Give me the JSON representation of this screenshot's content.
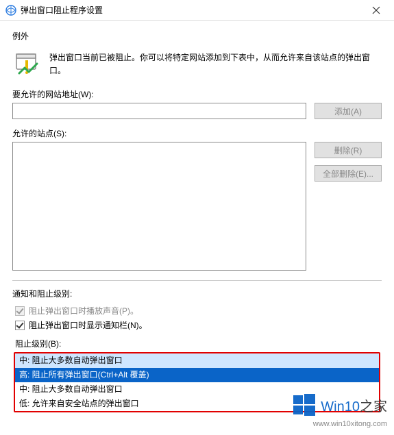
{
  "titlebar": {
    "title": "弹出窗口阻止程序设置",
    "close_label": "×"
  },
  "exceptions": {
    "group_label": "例外",
    "desc": "弹出窗口当前已被阻止。你可以将特定网站添加到下表中，从而允许来自该站点的弹出窗口。",
    "url_label": "要允许的网站地址(W):",
    "url_value": "",
    "add_btn": "添加(A)",
    "sites_label": "允许的站点(S):",
    "remove_btn": "删除(R)",
    "remove_all_btn": "全部删除(E)..."
  },
  "notify": {
    "group_label": "通知和阻止级别:",
    "play_sound": "阻止弹出窗口时播放声音(P)。",
    "show_bar": "阻止弹出窗口时显示通知栏(N)。"
  },
  "level": {
    "label": "阻止级别(B):",
    "options": [
      "中: 阻止大多数自动弹出窗口",
      "高: 阻止所有弹出窗口(Ctrl+Alt 覆盖)",
      "中: 阻止大多数自动弹出窗口",
      "低: 允许来自安全站点的弹出窗口"
    ]
  },
  "watermark": {
    "text1": "Win10",
    "text2": "之家",
    "url": "www.win10xitong.com"
  }
}
